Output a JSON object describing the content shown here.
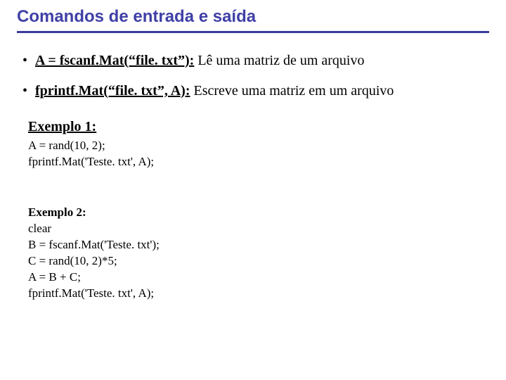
{
  "title": "Comandos de entrada e saída",
  "bullets": [
    {
      "cmd": "A = fscanf.Mat(“file. txt”):",
      "desc": " Lê uma matriz de um arquivo"
    },
    {
      "cmd": "fprintf.Mat(“file. txt”, A):",
      "desc": " Escreve uma matriz em um arquivo"
    }
  ],
  "example1": {
    "heading": "Exemplo 1:",
    "lines": "A = rand(10, 2);\nfprintf.Mat('Teste. txt', A);"
  },
  "example2": {
    "heading": "Exemplo 2:",
    "lines": "clear\nB = fscanf.Mat('Teste. txt');\nC = rand(10, 2)*5;\nA = B + C;\nfprintf.Mat('Teste. txt', A);"
  }
}
